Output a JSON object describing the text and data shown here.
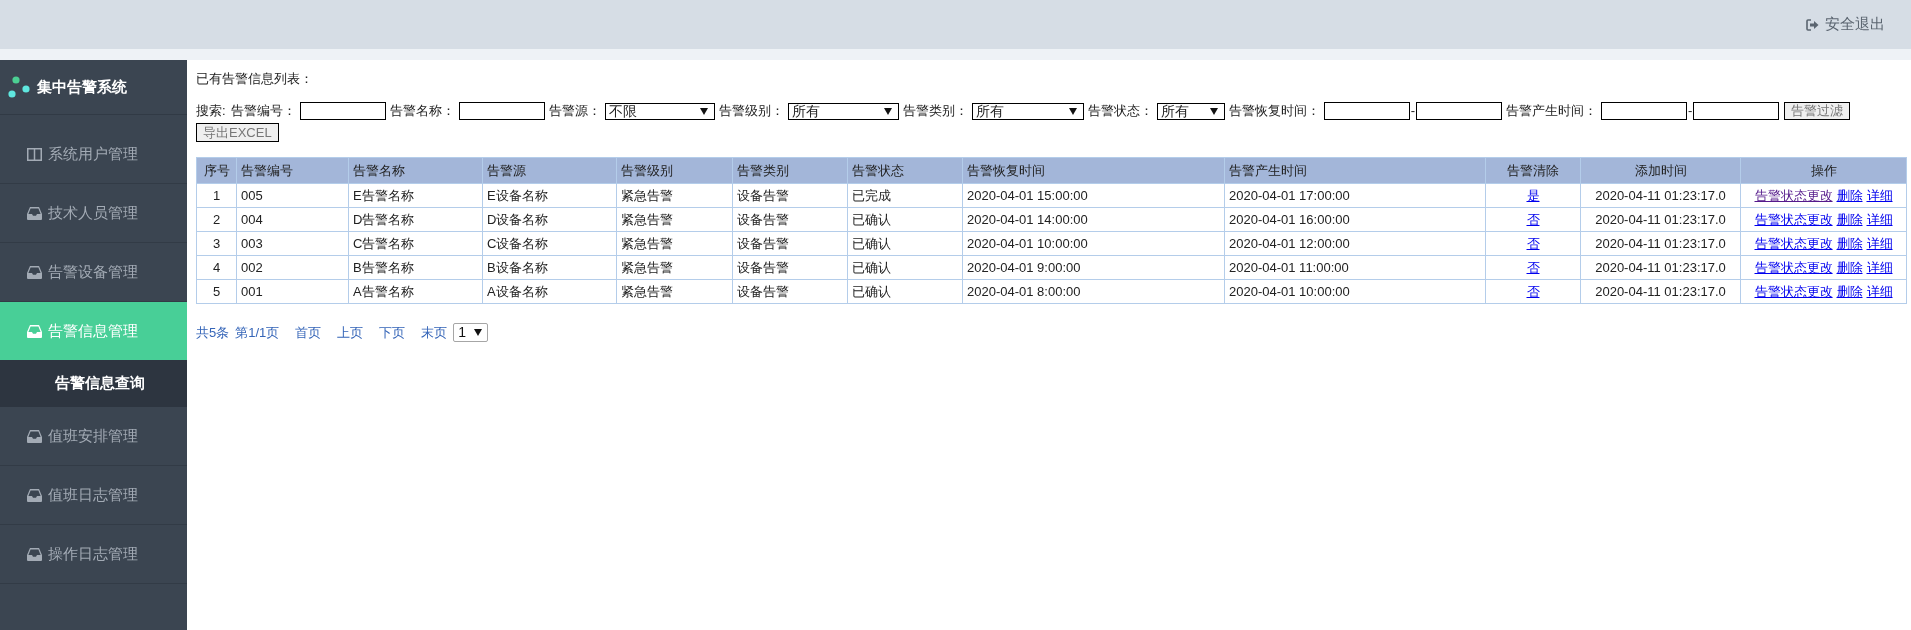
{
  "header": {
    "logout": "安全退出"
  },
  "sidebar": {
    "title": "集中告警系统",
    "items": [
      {
        "kind": "panel",
        "label": "系统用户管理",
        "selected": false
      },
      {
        "kind": "tray",
        "label": "技术人员管理",
        "selected": false
      },
      {
        "kind": "tray",
        "label": "告警设备管理",
        "selected": false
      },
      {
        "kind": "tray",
        "label": "告警信息管理",
        "selected": true,
        "children": [
          {
            "label": "告警信息查询",
            "selected": true
          }
        ]
      },
      {
        "kind": "tray",
        "label": "值班安排管理",
        "selected": false
      },
      {
        "kind": "tray",
        "label": "值班日志管理",
        "selected": false
      },
      {
        "kind": "tray",
        "label": "操作日志管理",
        "selected": false
      }
    ]
  },
  "page_title": "已有告警信息列表：",
  "search": {
    "label": "搜索:",
    "fields": [
      {
        "kind": "text",
        "label": "告警编号："
      },
      {
        "kind": "text",
        "label": "告警名称："
      },
      {
        "kind": "select",
        "label": "告警源：",
        "value": "不限"
      },
      {
        "kind": "select",
        "label": "告警级别：",
        "value": "所有"
      },
      {
        "kind": "select",
        "label": "告警类别：",
        "value": "所有"
      },
      {
        "kind": "select",
        "label": "告警状态：",
        "value": "所有"
      },
      {
        "kind": "range",
        "label": "告警恢复时间：",
        "separator": "-"
      },
      {
        "kind": "range",
        "label": "告警产生时间：",
        "separator": "-"
      }
    ],
    "filter_button": "告警过滤",
    "export_button": "导出EXCEL"
  },
  "table": {
    "columns": [
      "序号",
      "告警编号",
      "告警名称",
      "告警源",
      "告警级别",
      "告警类别",
      "告警状态",
      "告警恢复时间",
      "告警产生时间",
      "告警清除",
      "添加时间",
      "操作"
    ],
    "rows": [
      {
        "cells": [
          "1",
          "005",
          "E告警名称",
          "E设备名称",
          "紧急告警",
          "设备告警",
          "已完成",
          "2020-04-01 15:00:00",
          "2020-04-01 17:00:00"
        ],
        "clear": "是",
        "added_time": "2020-04-11 01:23:17.0",
        "actions": [
          {
            "label": "告警状态更改",
            "visited": true
          },
          {
            "label": "删除",
            "visited": false
          },
          {
            "label": "详细",
            "visited": false
          }
        ]
      },
      {
        "cells": [
          "2",
          "004",
          "D告警名称",
          "D设备名称",
          "紧急告警",
          "设备告警",
          "已确认",
          "2020-04-01 14:00:00",
          "2020-04-01 16:00:00"
        ],
        "clear": "否",
        "added_time": "2020-04-11 01:23:17.0",
        "actions": [
          {
            "label": "告警状态更改",
            "visited": false
          },
          {
            "label": "删除",
            "visited": false
          },
          {
            "label": "详细",
            "visited": false
          }
        ]
      },
      {
        "cells": [
          "3",
          "003",
          "C告警名称",
          "C设备名称",
          "紧急告警",
          "设备告警",
          "已确认",
          "2020-04-01 10:00:00",
          "2020-04-01 12:00:00"
        ],
        "clear": "否",
        "added_time": "2020-04-11 01:23:17.0",
        "actions": [
          {
            "label": "告警状态更改",
            "visited": false
          },
          {
            "label": "删除",
            "visited": false
          },
          {
            "label": "详细",
            "visited": false
          }
        ]
      },
      {
        "cells": [
          "4",
          "002",
          "B告警名称",
          "B设备名称",
          "紧急告警",
          "设备告警",
          "已确认",
          "2020-04-01 9:00:00",
          "2020-04-01 11:00:00"
        ],
        "clear": "否",
        "added_time": "2020-04-11 01:23:17.0",
        "actions": [
          {
            "label": "告警状态更改",
            "visited": false
          },
          {
            "label": "删除",
            "visited": false
          },
          {
            "label": "详细",
            "visited": false
          }
        ]
      },
      {
        "cells": [
          "5",
          "001",
          "A告警名称",
          "A设备名称",
          "紧急告警",
          "设备告警",
          "已确认",
          "2020-04-01 8:00:00",
          "2020-04-01 10:00:00"
        ],
        "clear": "否",
        "added_time": "2020-04-11 01:23:17.0",
        "actions": [
          {
            "label": "告警状态更改",
            "visited": false
          },
          {
            "label": "删除",
            "visited": false
          },
          {
            "label": "详细",
            "visited": false
          }
        ]
      }
    ]
  },
  "pagination": {
    "summary": "共5条",
    "page": "第1/1页",
    "links": [
      "首页",
      "上页",
      "下页",
      "末页"
    ],
    "page_select": "1"
  }
}
